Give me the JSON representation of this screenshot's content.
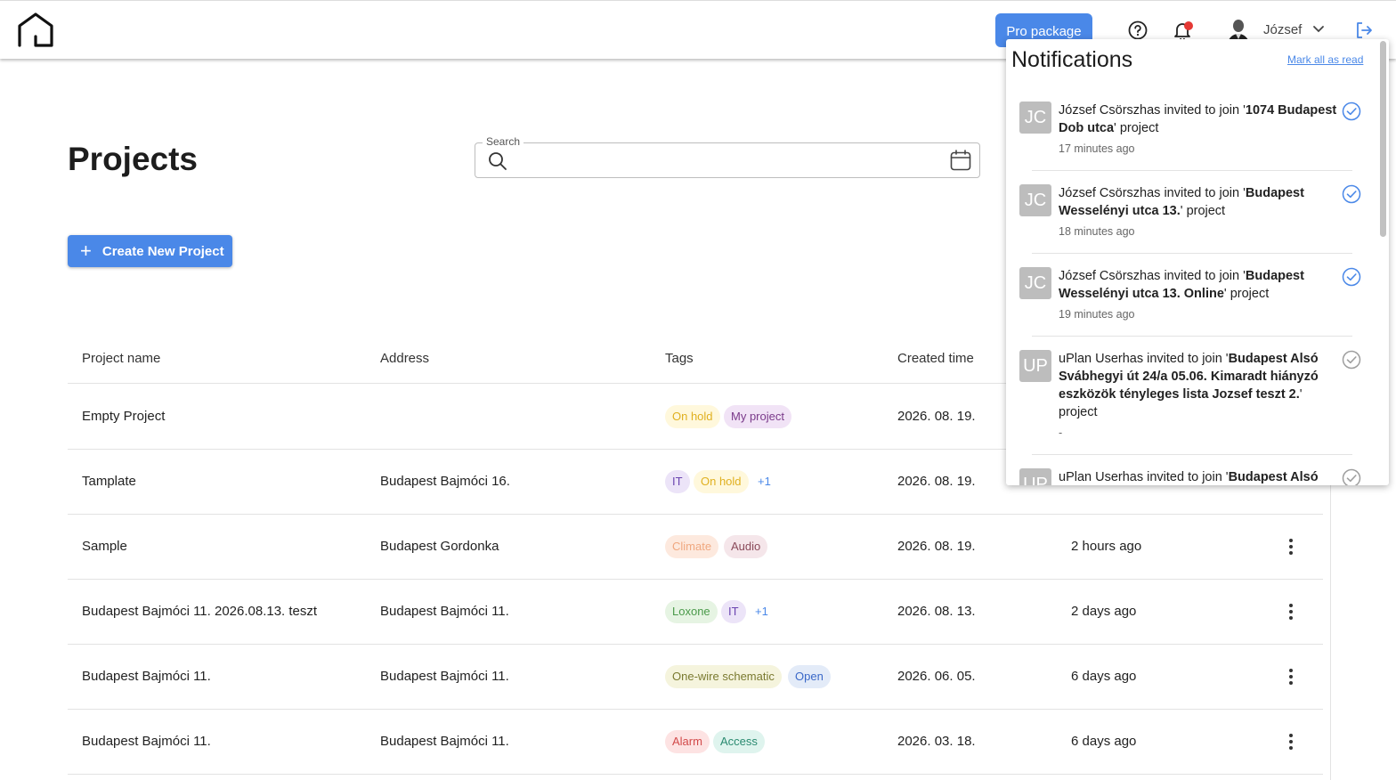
{
  "header": {
    "pro_label": "Pro package",
    "user_name": "József",
    "icons": [
      "home-logo-icon",
      "help-icon",
      "bell-icon",
      "chevron-down-icon",
      "logout-icon"
    ]
  },
  "page": {
    "title": "Projects",
    "search_label": "Search",
    "search_value": "",
    "create_label": "Create New Project"
  },
  "table": {
    "headers": [
      "Project name",
      "Address",
      "Tags",
      "Created time"
    ],
    "rows": [
      {
        "name": "Empty Project",
        "address": "",
        "tags": [
          "On hold",
          "My project"
        ],
        "more": "",
        "created": "2026. 08. 19.",
        "modified": ""
      },
      {
        "name": "Tamplate",
        "address": "Budapest Bajmóci 16.",
        "tags": [
          "IT",
          "On hold"
        ],
        "more": "+1",
        "created": "2026. 08. 19.",
        "modified": ""
      },
      {
        "name": "Sample",
        "address": "Budapest Gordonka",
        "tags": [
          "Climate",
          "Audio"
        ],
        "more": "",
        "created": "2026. 08. 19.",
        "modified": "2 hours ago"
      },
      {
        "name": "Budapest Bajmóci 11. 2026.08.13. teszt",
        "address": "Budapest Bajmóci 11.",
        "tags": [
          "Loxone",
          "IT"
        ],
        "more": "+1",
        "created": "2026. 08. 13.",
        "modified": "2 days ago"
      },
      {
        "name": "Budapest Bajmóci 11.",
        "address": "Budapest Bajmóci 11.",
        "tags": [
          "One-wire schematic",
          "Open"
        ],
        "more": "",
        "created": "2026. 06. 05.",
        "modified": "6 days ago"
      },
      {
        "name": "Budapest Bajmóci 11.",
        "address": "Budapest Bajmóci 11.",
        "tags": [
          "Alarm",
          "Access"
        ],
        "more": "",
        "created": "2026. 03. 18.",
        "modified": "6 days ago"
      }
    ]
  },
  "tag_colors": {
    "On hold": {
      "bg": "#fff8dc",
      "fg": "#e0b020"
    },
    "My project": {
      "bg": "#f1e3f6",
      "fg": "#7a3a8a"
    },
    "IT": {
      "bg": "#ece4f8",
      "fg": "#6a44b0"
    },
    "Climate": {
      "bg": "#fde9de",
      "fg": "#f0a880"
    },
    "Audio": {
      "bg": "#f5e6ea",
      "fg": "#8a4a5a"
    },
    "Loxone": {
      "bg": "#e6f4e3",
      "fg": "#4a9a4a"
    },
    "One-wire schematic": {
      "bg": "#f5f4dd",
      "fg": "#7a7a30"
    },
    "Open": {
      "bg": "#e3ebf8",
      "fg": "#3a68c8"
    },
    "Alarm": {
      "bg": "#fde3e3",
      "fg": "#d24a4a"
    },
    "Access": {
      "bg": "#dff4ee",
      "fg": "#2a8a70"
    }
  },
  "notifications": {
    "title": "Notifications",
    "mark_all": "Mark all as read",
    "items": [
      {
        "initials": "JC",
        "pre": "József Csörszhas invited to join '",
        "bold": "1074 Budapest Dob utca",
        "post": "' project",
        "time": "17 minutes ago",
        "read": false
      },
      {
        "initials": "JC",
        "pre": "József Csörszhas invited to join '",
        "bold": "Budapest Wesselényi utca 13.",
        "post": "' project",
        "time": "18 minutes ago",
        "read": false
      },
      {
        "initials": "JC",
        "pre": "József Csörszhas invited to join '",
        "bold": "Budapest Wesselényi utca 13. Online",
        "post": "' project",
        "time": "19 minutes ago",
        "read": false
      },
      {
        "initials": "UP",
        "pre": "uPlan Userhas invited to join '",
        "bold": "Budapest Alsó Svábhegyi út 24/a 05.06. Kimaradt hiányzó eszközök tényleges lista Jozsef teszt 2.",
        "post": "' project",
        "time": "-",
        "read": true
      },
      {
        "initials": "UP",
        "pre": "uPlan Userhas invited to join '",
        "bold": "Budapest Alsó",
        "post": "",
        "time": "",
        "read": true
      }
    ]
  },
  "colors": {
    "accent": "#4a88e8",
    "notification_dot": "#e53935"
  }
}
